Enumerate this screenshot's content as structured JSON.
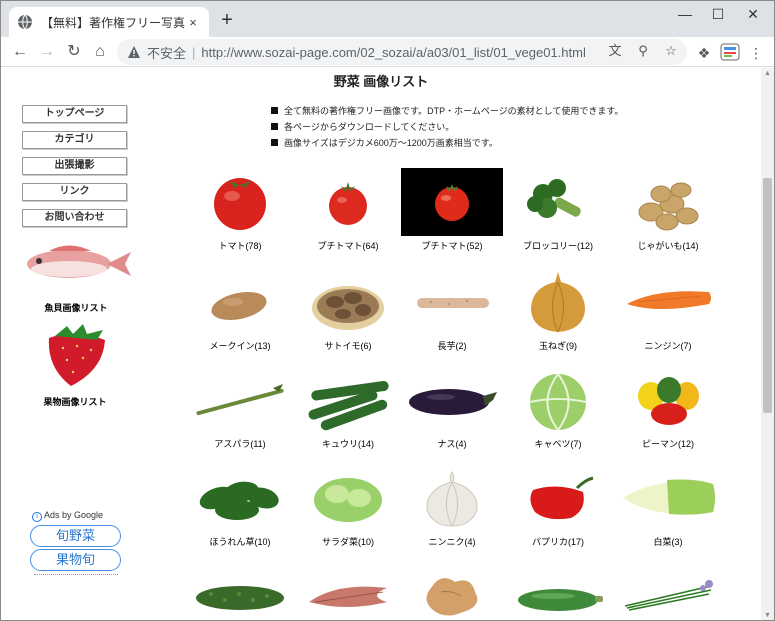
{
  "browser": {
    "tab_title": "【無料】著作権フリー写真素材",
    "tab_close": "×",
    "new_tab": "+",
    "insecure_label": "不安全",
    "url": "http://www.sozai-page.com/02_sozai/a/a03/01_list/01_vege01.html"
  },
  "page": {
    "title": "野菜 画像リスト",
    "notes": [
      "全て無料の著作権フリー画像です。DTP・ホームページの素材として使用できます。",
      "各ページからダウンロードしてください。",
      "画像サイズはデジカメ600万～1200万画素相当です。"
    ],
    "sidebar": {
      "nav": [
        "トップページ",
        "カテゴリ",
        "出張撮影",
        "リンク",
        "お問い合わせ"
      ],
      "fish_caption": "魚貝画像リスト",
      "fruit_caption": "果物画像リスト",
      "ads_label": "Ads by Google",
      "ad_buttons": [
        "旬野菜",
        "果物旬"
      ]
    },
    "items": [
      {
        "label": "トマト(78)",
        "icon": "tomato"
      },
      {
        "label": "プチトマト(64)",
        "icon": "cherry-tomato"
      },
      {
        "label": "プチトマト(52)",
        "icon": "cherry-tomato-dark"
      },
      {
        "label": "ブロッコリー(12)",
        "icon": "broccoli"
      },
      {
        "label": "じゃがいも(14)",
        "icon": "potatoes"
      },
      {
        "label": "メークイン(13)",
        "icon": "may-queen-potato"
      },
      {
        "label": "サトイモ(6)",
        "icon": "taro"
      },
      {
        "label": "長芋(2)",
        "icon": "yam"
      },
      {
        "label": "玉ねぎ(9)",
        "icon": "onion"
      },
      {
        "label": "ニンジン(7)",
        "icon": "carrot"
      },
      {
        "label": "アスパラ(11)",
        "icon": "asparagus"
      },
      {
        "label": "キュウリ(14)",
        "icon": "cucumber"
      },
      {
        "label": "ナス(4)",
        "icon": "eggplant"
      },
      {
        "label": "キャベツ(7)",
        "icon": "cabbage"
      },
      {
        "label": "ピーマン(12)",
        "icon": "bell-peppers"
      },
      {
        "label": "ほうれん草(10)",
        "icon": "spinach"
      },
      {
        "label": "サラダ菜(10)",
        "icon": "lettuce"
      },
      {
        "label": "ニンニク(4)",
        "icon": "garlic"
      },
      {
        "label": "パプリカ(17)",
        "icon": "paprika"
      },
      {
        "label": "白菜(3)",
        "icon": "napa-cabbage"
      },
      {
        "label": "",
        "icon": "bitter-melon"
      },
      {
        "label": "",
        "icon": "myoga"
      },
      {
        "label": "",
        "icon": "ginger"
      },
      {
        "label": "",
        "icon": "zucchini"
      },
      {
        "label": "",
        "icon": "chives"
      }
    ]
  }
}
